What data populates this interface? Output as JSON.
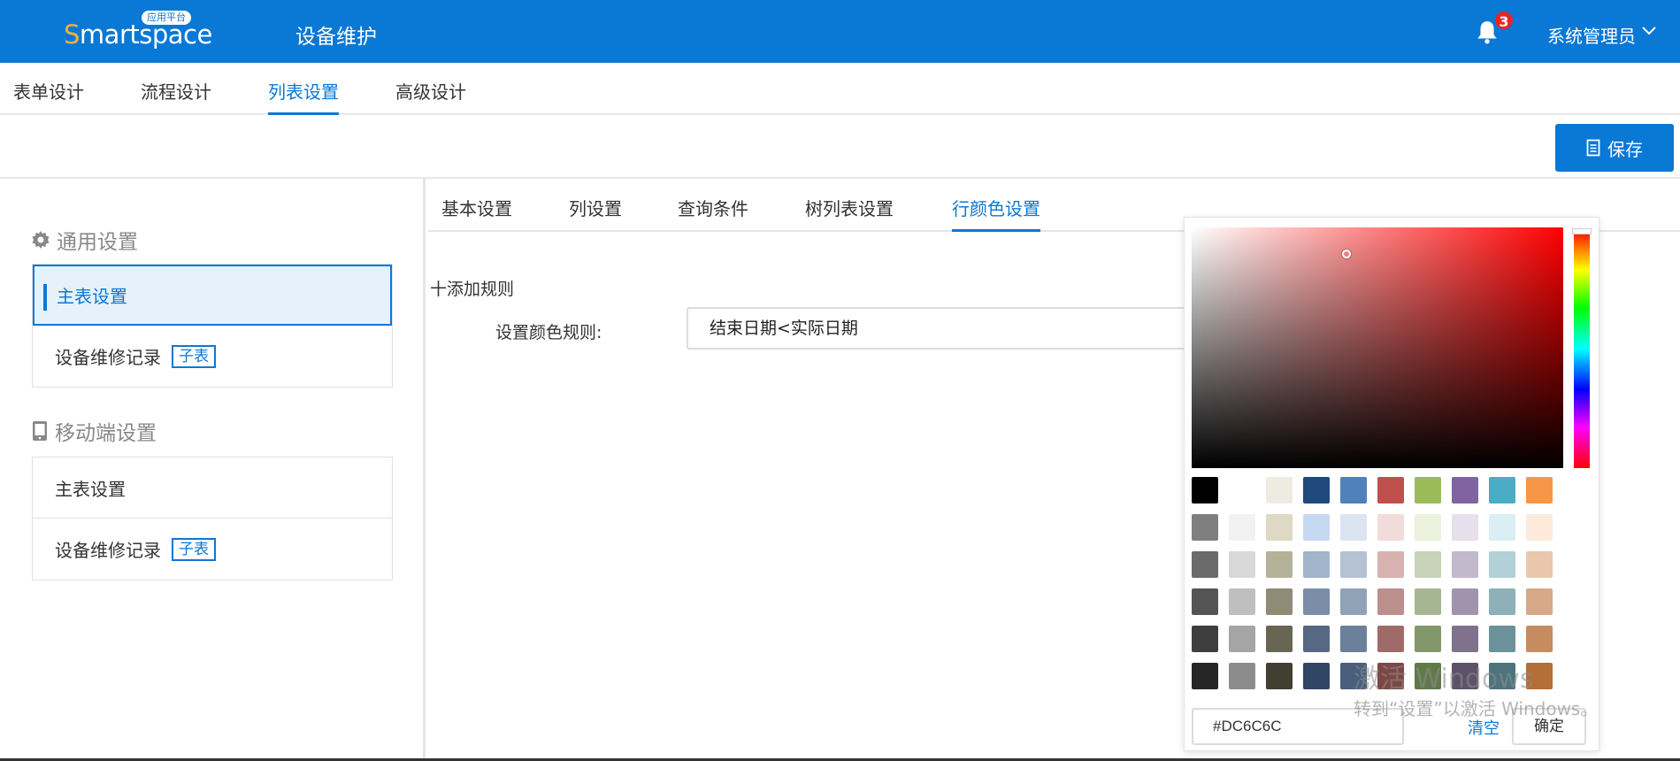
{
  "header": {
    "logo_text": "Smartspace",
    "logo_badge": "应用平台",
    "title": "设备维护",
    "notification_count": "3",
    "user": "系统管理员"
  },
  "top_tabs": [
    {
      "label": "表单设计",
      "active": false
    },
    {
      "label": "流程设计",
      "active": false
    },
    {
      "label": "列表设置",
      "active": true
    },
    {
      "label": "高级设计",
      "active": false
    }
  ],
  "toolbar": {
    "save_label": "保存"
  },
  "left_panel": {
    "general": {
      "title": "通用设置",
      "items": [
        {
          "label": "主表设置",
          "active": true,
          "tag": ""
        },
        {
          "label": "设备维修记录",
          "active": false,
          "tag": "子表"
        }
      ]
    },
    "mobile": {
      "title": "移动端设置",
      "items": [
        {
          "label": "主表设置",
          "active": false,
          "tag": ""
        },
        {
          "label": "设备维修记录",
          "active": false,
          "tag": "子表"
        }
      ]
    }
  },
  "sub_tabs": [
    {
      "label": "基本设置",
      "active": false
    },
    {
      "label": "列设置",
      "active": false
    },
    {
      "label": "查询条件",
      "active": false
    },
    {
      "label": "树列表设置",
      "active": false
    },
    {
      "label": "行颜色设置",
      "active": true
    }
  ],
  "rule": {
    "add_label": "十添加规则",
    "label": "设置颜色规则:",
    "value": "结束日期<实际日期"
  },
  "color_picker": {
    "hex_value": "#DC6C6C",
    "clear_label": "清空",
    "ok_label": "确定",
    "swatch_rows": [
      [
        "#000000",
        "#ffffff",
        "#eeece1",
        "#1f497d",
        "#4f81bd",
        "#c0504d",
        "#9bbb59",
        "#8064a2",
        "#4bacc6",
        "#f79646"
      ],
      [
        "#7f7f7f",
        "#f2f2f2",
        "#ddd9c3",
        "#c6d9f0",
        "#dbe5f1",
        "#f2dcdb",
        "#ebf1dd",
        "#e5e0ec",
        "#dbeef3",
        "#fdeada"
      ],
      [
        "#6b6b6b",
        "#d8d8d8",
        "#b5b29a",
        "#a2b3cc",
        "#b4c2d4",
        "#d8b2b0",
        "#c8d3b8",
        "#c2b9cc",
        "#b1d1d6",
        "#e9c7ad"
      ],
      [
        "#555555",
        "#bfbfbf",
        "#8e8b77",
        "#7b8da8",
        "#8fa2b6",
        "#bc8e8c",
        "#a6b592",
        "#a193ad",
        "#8eb0b8",
        "#d7a989"
      ],
      [
        "#3e3e3e",
        "#a5a5a5",
        "#686652",
        "#566884",
        "#6b8199",
        "#9f6b69",
        "#83976d",
        "#80728c",
        "#6b929a",
        "#c68c5f"
      ],
      [
        "#262626",
        "#8c8c8c",
        "#403f31",
        "#304464",
        "#4a5f7e",
        "#7d4745",
        "#617949",
        "#5e516a",
        "#4d747d",
        "#b46e37"
      ]
    ]
  },
  "watermark": {
    "line1": "激活 Windows",
    "line2": "转到“设置”以激活 Windows。"
  }
}
